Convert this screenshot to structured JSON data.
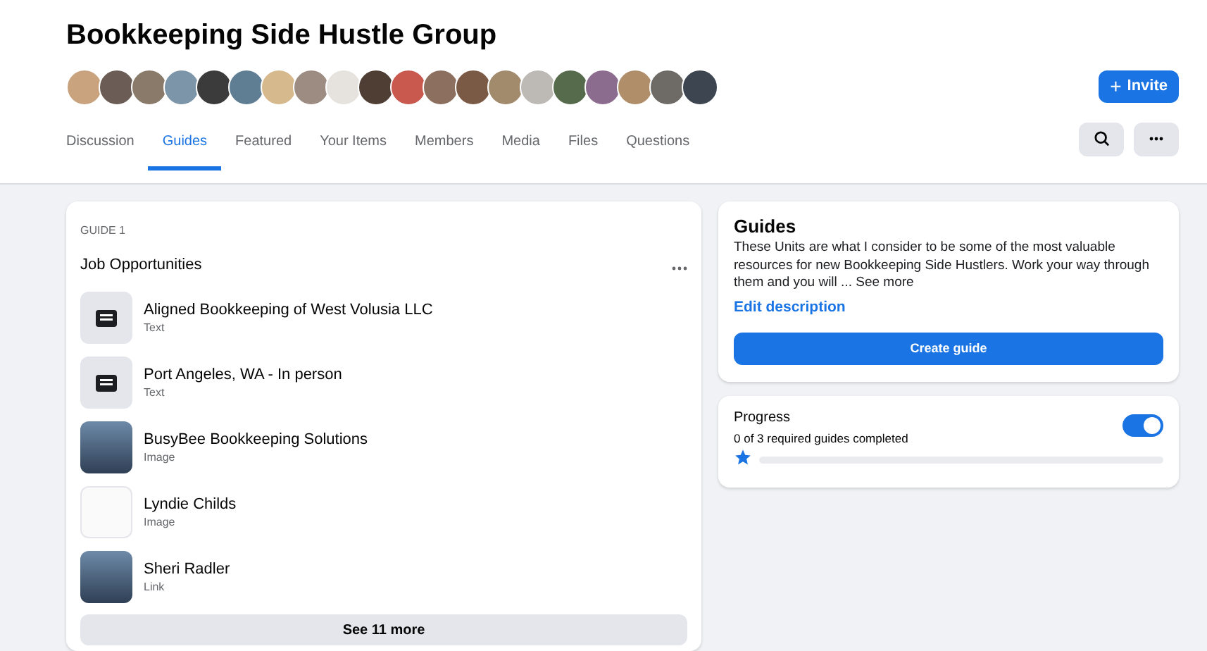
{
  "group": {
    "title": "Bookkeeping Side Hustle Group",
    "invite_button": "Invite",
    "invite_icon": "+"
  },
  "tabs": [
    {
      "label": "Discussion",
      "selected": false
    },
    {
      "label": "Guides",
      "selected": true
    },
    {
      "label": "Featured",
      "selected": false
    },
    {
      "label": "Your Items",
      "selected": false
    },
    {
      "label": "Members",
      "selected": false
    },
    {
      "label": "Media",
      "selected": false
    },
    {
      "label": "Files",
      "selected": false
    },
    {
      "label": "Questions",
      "selected": false
    }
  ],
  "guide": {
    "number": "GUIDE 1",
    "title": "Job Opportunities",
    "items": [
      {
        "title": "Aligned Bookkeeping of West Volusia LLC",
        "type": "Text",
        "kind": "text"
      },
      {
        "title": "Port Angeles, WA - In person",
        "type": "Text",
        "kind": "text"
      },
      {
        "title": "BusyBee Bookkeeping Solutions",
        "type": "Image",
        "kind": "photo"
      },
      {
        "title": "Lyndie Childs",
        "type": "Image",
        "kind": "signature"
      },
      {
        "title": "Sheri Radler",
        "type": "Link",
        "kind": "photo"
      }
    ],
    "see_more": "See 11 more"
  },
  "about": {
    "title": "Guides",
    "description": "These Units are what I consider to be some of the most valuable resources for new Bookkeeping Side Hustlers. Work your way through them and you will ...",
    "see_more": "See more",
    "edit_link": "Edit description",
    "create_button": "Create guide"
  },
  "progress": {
    "title": "Progress",
    "summary": "0 of 3 required guides completed",
    "on": true,
    "level": 0
  }
}
